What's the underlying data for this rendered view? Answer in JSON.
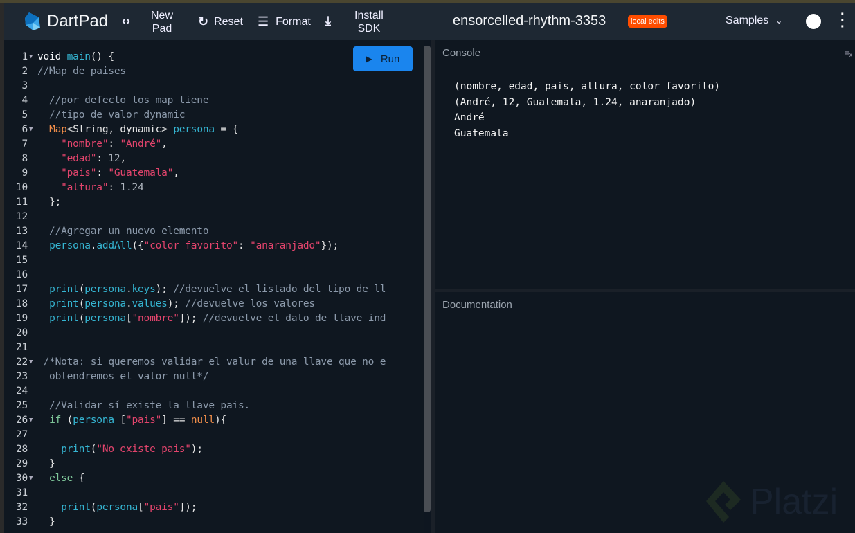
{
  "header": {
    "app_name": "DartPad",
    "new_pad": [
      "New",
      "Pad"
    ],
    "reset": "Reset",
    "format": "Format",
    "install": [
      "Install",
      "SDK"
    ],
    "pad_title": "ensorcelled-rhythm-3353",
    "badge": "local edits",
    "samples": "Samples"
  },
  "editor": {
    "run": "Run",
    "lines": [
      {
        "n": "1",
        "fold": true,
        "t": [
          [
            "kw",
            "void "
          ],
          [
            "fn",
            "main"
          ],
          [
            "p",
            "() {"
          ]
        ]
      },
      {
        "n": "2",
        "t": [
          [
            "com",
            "//Map de paises"
          ]
        ]
      },
      {
        "n": "3",
        "t": []
      },
      {
        "n": "4",
        "t": [
          [
            "com",
            "  //por defecto los map tiene"
          ]
        ]
      },
      {
        "n": "5",
        "t": [
          [
            "com",
            "  //tipo de valor dynamic"
          ]
        ]
      },
      {
        "n": "6",
        "fold": true,
        "t": [
          [
            "p",
            "  "
          ],
          [
            "type",
            "Map"
          ],
          [
            "p",
            "<String, dynamic> "
          ],
          [
            "fn",
            "persona"
          ],
          [
            "p",
            " = {"
          ]
        ]
      },
      {
        "n": "7",
        "t": [
          [
            "p",
            "    "
          ],
          [
            "str",
            "\"nombre\""
          ],
          [
            "p",
            ": "
          ],
          [
            "str",
            "\"André\""
          ],
          [
            "p",
            ","
          ]
        ]
      },
      {
        "n": "8",
        "t": [
          [
            "p",
            "    "
          ],
          [
            "str",
            "\"edad\""
          ],
          [
            "p",
            ": "
          ],
          [
            "num",
            "12"
          ],
          [
            "p",
            ","
          ]
        ]
      },
      {
        "n": "9",
        "t": [
          [
            "p",
            "    "
          ],
          [
            "str",
            "\"pais\""
          ],
          [
            "p",
            ": "
          ],
          [
            "str",
            "\"Guatemala\""
          ],
          [
            "p",
            ","
          ]
        ]
      },
      {
        "n": "10",
        "t": [
          [
            "p",
            "    "
          ],
          [
            "str",
            "\"altura\""
          ],
          [
            "p",
            ": "
          ],
          [
            "num",
            "1.24"
          ]
        ]
      },
      {
        "n": "11",
        "t": [
          [
            "p",
            "  };"
          ]
        ]
      },
      {
        "n": "12",
        "t": []
      },
      {
        "n": "13",
        "t": [
          [
            "com",
            "  //Agregar un nuevo elemento"
          ]
        ]
      },
      {
        "n": "14",
        "t": [
          [
            "p",
            "  "
          ],
          [
            "fn",
            "persona"
          ],
          [
            "p",
            "."
          ],
          [
            "fn",
            "addAll"
          ],
          [
            "p",
            "({"
          ],
          [
            "str",
            "\"color favorito\""
          ],
          [
            "p",
            ": "
          ],
          [
            "str",
            "\"anaranjado\""
          ],
          [
            "p",
            "});"
          ]
        ]
      },
      {
        "n": "15",
        "t": []
      },
      {
        "n": "16",
        "t": []
      },
      {
        "n": "17",
        "t": [
          [
            "p",
            "  "
          ],
          [
            "fn",
            "print"
          ],
          [
            "p",
            "("
          ],
          [
            "fn",
            "persona"
          ],
          [
            "p",
            "."
          ],
          [
            "fn",
            "keys"
          ],
          [
            "p",
            "); "
          ],
          [
            "com",
            "//devuelve el listado del tipo de ll"
          ]
        ]
      },
      {
        "n": "18",
        "t": [
          [
            "p",
            "  "
          ],
          [
            "fn",
            "print"
          ],
          [
            "p",
            "("
          ],
          [
            "fn",
            "persona"
          ],
          [
            "p",
            "."
          ],
          [
            "fn",
            "values"
          ],
          [
            "p",
            "); "
          ],
          [
            "com",
            "//devuelve los valores"
          ]
        ]
      },
      {
        "n": "19",
        "t": [
          [
            "p",
            "  "
          ],
          [
            "fn",
            "print"
          ],
          [
            "p",
            "("
          ],
          [
            "fn",
            "persona"
          ],
          [
            "p",
            "["
          ],
          [
            "str",
            "\"nombre\""
          ],
          [
            "p",
            "]); "
          ],
          [
            "com",
            "//devuelve el dato de llave ind"
          ]
        ]
      },
      {
        "n": "20",
        "t": []
      },
      {
        "n": "21",
        "t": []
      },
      {
        "n": "22",
        "fold": true,
        "t": [
          [
            "com",
            " /*Nota: si queremos validar el valur de una llave que no e"
          ]
        ]
      },
      {
        "n": "23",
        "t": [
          [
            "com",
            "  obtendremos el valor null*/"
          ]
        ]
      },
      {
        "n": "24",
        "t": []
      },
      {
        "n": "25",
        "t": [
          [
            "com",
            "  //Validar sí existe la llave pais."
          ]
        ]
      },
      {
        "n": "26",
        "fold": true,
        "t": [
          [
            "p",
            "  "
          ],
          [
            "ctl",
            "if"
          ],
          [
            "p",
            " ("
          ],
          [
            "fn",
            "persona"
          ],
          [
            "p",
            " ["
          ],
          [
            "str",
            "\"pais\""
          ],
          [
            "p",
            "] == "
          ],
          [
            "type",
            "null"
          ],
          [
            "p",
            "){"
          ]
        ]
      },
      {
        "n": "27",
        "t": []
      },
      {
        "n": "28",
        "t": [
          [
            "p",
            "    "
          ],
          [
            "fn",
            "print"
          ],
          [
            "p",
            "("
          ],
          [
            "str",
            "\"No existe pais\""
          ],
          [
            "p",
            ");"
          ]
        ]
      },
      {
        "n": "29",
        "t": [
          [
            "p",
            "  }"
          ]
        ]
      },
      {
        "n": "30",
        "fold": true,
        "t": [
          [
            "p",
            "  "
          ],
          [
            "ctl",
            "else"
          ],
          [
            "p",
            " {"
          ]
        ]
      },
      {
        "n": "31",
        "t": []
      },
      {
        "n": "32",
        "t": [
          [
            "p",
            "    "
          ],
          [
            "fn",
            "print"
          ],
          [
            "p",
            "("
          ],
          [
            "fn",
            "persona"
          ],
          [
            "p",
            "["
          ],
          [
            "str",
            "\"pais\""
          ],
          [
            "p",
            "]);"
          ]
        ]
      },
      {
        "n": "33",
        "t": [
          [
            "p",
            "  }"
          ]
        ]
      }
    ]
  },
  "console": {
    "title": "Console",
    "output": [
      "(nombre, edad, pais, altura, color favorito)",
      "(André, 12, Guatemala, 1.24, anaranjado)",
      "André",
      "Guatemala"
    ]
  },
  "docs": {
    "title": "Documentation"
  },
  "watermark": "Platzi",
  "colors": {
    "accent": "#1a85ee",
    "badge": "#ff4d00"
  }
}
